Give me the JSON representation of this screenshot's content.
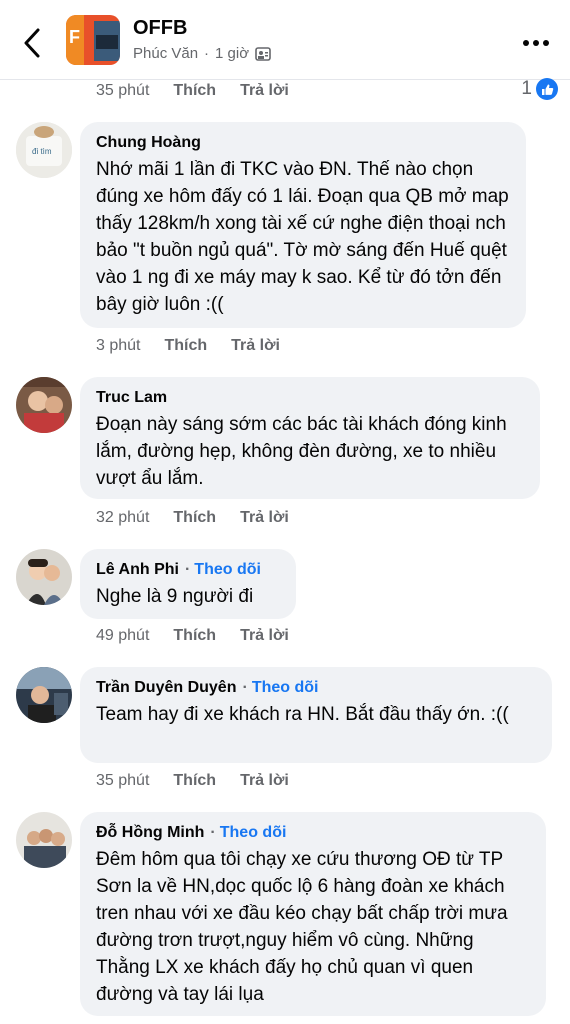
{
  "header": {
    "page_name": "OFFB",
    "author": "Phúc Văn",
    "time": "1 giờ",
    "separator": "·"
  },
  "top_comment_meta": {
    "time": "35 phút",
    "like": "Thích",
    "reply": "Trả lời",
    "like_count": "1"
  },
  "comments": [
    {
      "name": "Chung Hoàng",
      "follow": "",
      "text": "Nhớ mãi 1 lần đi TKC vào ĐN. Thế nào chọn đúng xe hôm đấy có 1 lái. Đoạn qua QB mở map thấy 128km/h xong tài xế cứ nghe điện thoại nch bảo \"t buồn ngủ quá\". Tờ mờ sáng đến Huế quệt vào 1 ng đi xe máy may k sao. Kể từ đó tởn đến bây giờ luôn :((",
      "time": "3 phút",
      "like": "Thích",
      "reply": "Trả lời"
    },
    {
      "name": "Truc Lam",
      "follow": "",
      "text": "Đoạn này sáng sớm các bác tài khách đóng kinh lắm, đường hẹp, không đèn đường, xe to nhiều vượt ẩu lắm.",
      "time": "32 phút",
      "like": "Thích",
      "reply": "Trả lời"
    },
    {
      "name": "Lê Anh Phi",
      "follow": "Theo dõi",
      "text": "Nghe là 9 người đi",
      "time": "49 phút",
      "like": "Thích",
      "reply": "Trả lời"
    },
    {
      "name": "Trần Duyên Duyên",
      "follow": "Theo dõi",
      "text": "Team hay đi xe khách ra HN. Bắt đầu thấy ớn. :((",
      "time": "35 phút",
      "like": "Thích",
      "reply": "Trả lời"
    },
    {
      "name": "Đỗ Hồng Minh",
      "follow": "Theo dõi",
      "text": "Đêm hôm qua tôi chạy xe cứu thương OĐ từ TP Sơn la về HN,dọc quốc lộ 6 hàng đoàn xe khách tren nhau với xe đầu kéo chạy bất chấp trời mưa đường trơn trượt,nguy hiểm vô cùng. Những Thằng LX xe khách đấy họ chủ quan vì quen đường và tay lái lụa",
      "time": "",
      "like": "",
      "reply": ""
    }
  ],
  "colors": {
    "link": "#1877f2",
    "meta": "#65676b",
    "bubble": "#f0f2f5"
  },
  "icons": {
    "back": "chevron-left-icon",
    "more": "more-dots-icon",
    "audience": "friends-audience-icon",
    "like": "thumbs-up-icon"
  }
}
